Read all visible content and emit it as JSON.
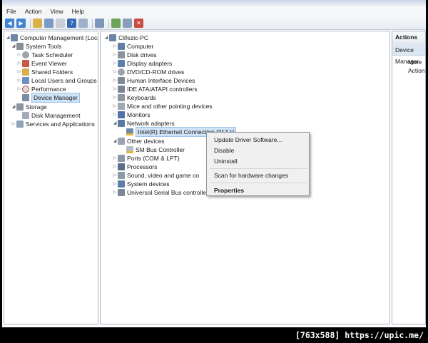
{
  "menu": [
    "File",
    "Action",
    "View",
    "Help"
  ],
  "left_tree": {
    "root": "Computer Management (Local",
    "system_tools": "System Tools",
    "system_children": [
      "Task Scheduler",
      "Event Viewer",
      "Shared Folders",
      "Local Users and Groups",
      "Performance",
      "Device Manager"
    ],
    "storage": "Storage",
    "disk_mgmt": "Disk Management",
    "services": "Services and Applications"
  },
  "device_tree": {
    "computer_name": "Clifezic-PC",
    "categories": [
      "Computer",
      "Disk drives",
      "Display adapters",
      "DVD/CD-ROM drives",
      "Human Interface Devices",
      "IDE ATA/ATAPI controllers",
      "Keyboards",
      "Mice and other pointing devices",
      "Monitors"
    ],
    "network": "Network adapters",
    "network_child": "Intel(R) Ethernet Connection I217-V",
    "other": "Other devices",
    "other_child": "SM Bus Controller",
    "rest": [
      "Ports (COM & LPT)",
      "Processors",
      "Sound, video and game co",
      "System devices",
      "Universal Serial Bus controllers"
    ]
  },
  "actions": {
    "header": "Actions",
    "subheader": "Device Manager",
    "more": "More Actions"
  },
  "context_menu": {
    "update": "Update Driver Software...",
    "disable": "Disable",
    "uninstall": "Uninstall",
    "scan": "Scan for hardware changes",
    "properties": "Properties"
  },
  "footer": "[763x588] https://upic.me/"
}
